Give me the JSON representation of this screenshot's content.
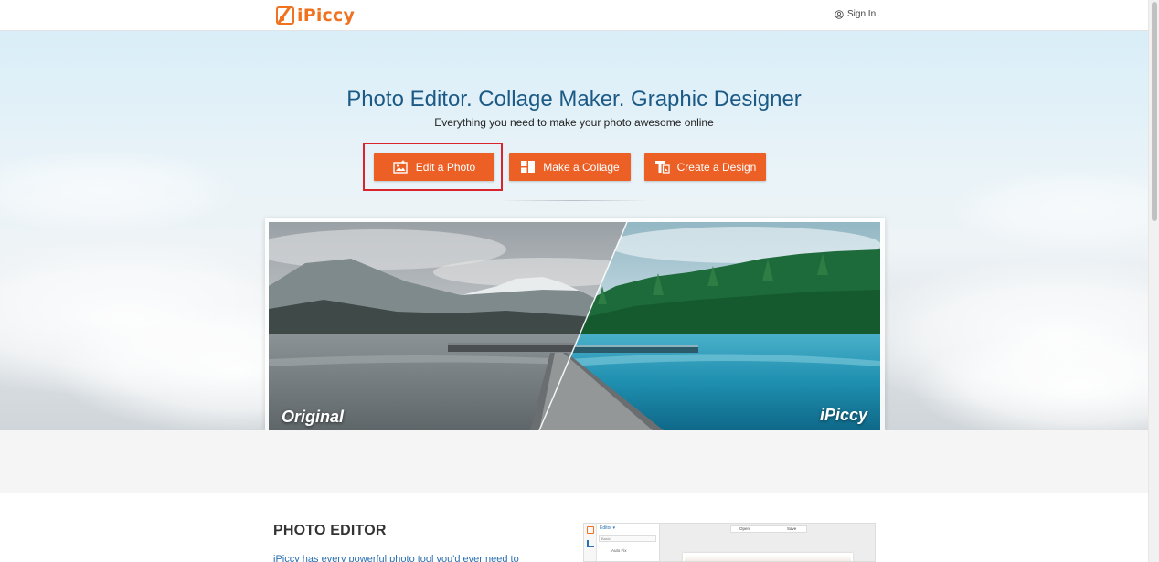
{
  "header": {
    "logo_text": "iPiccy",
    "logo_icon": "ipiccy-logo-icon",
    "signin_label": "Sign In",
    "signin_icon": "user-circle-icon"
  },
  "hero": {
    "title": "Photo Editor. Collage Maker. Graphic Designer",
    "subtitle": "Everything you need to make your photo awesome online",
    "buttons": [
      {
        "label": "Edit a Photo",
        "icon": "photo-edit-icon"
      },
      {
        "label": "Make a Collage",
        "icon": "collage-grid-icon"
      },
      {
        "label": "Create a Design",
        "icon": "text-design-icon"
      }
    ],
    "compare": {
      "left_label": "Original",
      "right_label": "iPiccy"
    }
  },
  "section": {
    "title": "PHOTO EDITOR",
    "text": "iPiccy has every powerful photo tool you'd ever need to"
  },
  "preview": {
    "editor_label": "Editor ▾",
    "basic_label": "Basic",
    "autofix_label": "Auto Fix",
    "open_label": "Open",
    "save_label": "Save"
  },
  "colors": {
    "accent": "#ec5f25",
    "brand": "#f0721f",
    "title": "#1c5a86",
    "highlight": "#d9232d"
  }
}
